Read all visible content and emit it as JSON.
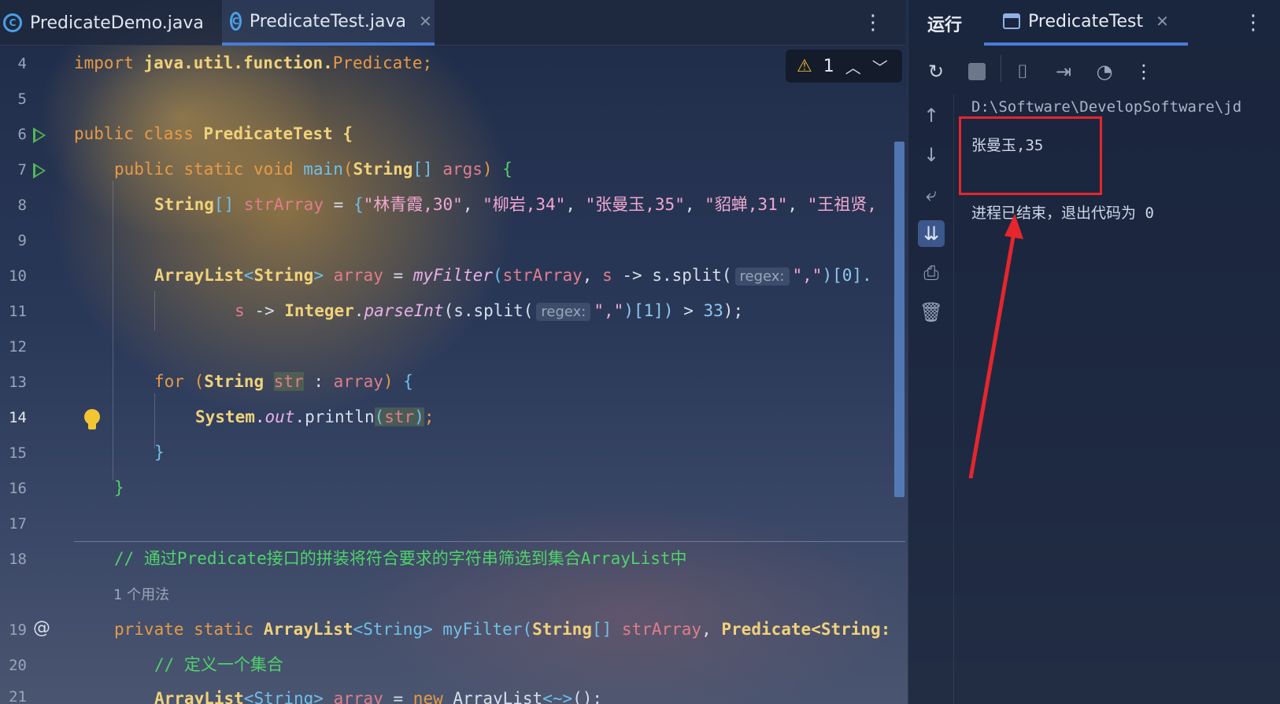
{
  "tabs": [
    {
      "label": "PredicateDemo.java"
    },
    {
      "label": "PredicateTest.java",
      "active": true
    }
  ],
  "inspection": {
    "count": "1"
  },
  "code_lines": [
    {
      "no": "4"
    },
    {
      "no": "5"
    },
    {
      "no": "6"
    },
    {
      "no": "7"
    },
    {
      "no": "8"
    },
    {
      "no": "9"
    },
    {
      "no": "10"
    },
    {
      "no": "11"
    },
    {
      "no": "12"
    },
    {
      "no": "13"
    },
    {
      "no": "14"
    },
    {
      "no": "15"
    },
    {
      "no": "16"
    },
    {
      "no": "17"
    },
    {
      "no": "18"
    },
    {
      "no": "19"
    },
    {
      "no": "20"
    },
    {
      "no": "21"
    }
  ],
  "code": {
    "l4": {
      "kw": "import",
      "pkg": "java.util.function.",
      "cls": "Predicate",
      "semi": ";"
    },
    "l6": {
      "kw1": "public",
      "kw2": "class",
      "name": "PredicateTest",
      "brace": "{"
    },
    "l7": {
      "kw1": "public",
      "kw2": "static",
      "kw3": "void",
      "fn": "main",
      "open": "(",
      "type": "String",
      "arr": "[]",
      "arg": "args",
      "close": ")",
      "brace": "{"
    },
    "l8": {
      "type": "String",
      "arr": "[]",
      "var": "strArray",
      "eq": "=",
      "open": "{",
      "s1": "\"林青霞,30\"",
      "s2": "\"柳岩,34\"",
      "s3": "\"张曼玉,35\"",
      "s4": "\"貂蝉,31\"",
      "s5": "\"王祖贤,"
    },
    "l10": {
      "type": "ArrayList",
      "gen": "<",
      "gtype": "String",
      "gend": ">",
      "var": "array",
      "eq": "=",
      "fn": "myFilter",
      "open": "(",
      "arg": "strArray",
      "comma": ",",
      "lam": "s",
      "arrow": "->",
      "call": "s.split(",
      "hint": "regex:",
      "str": "\",\"",
      "rest": ")[0]."
    },
    "l11": {
      "lam": "s",
      "arrow": "->",
      "cls": "Integer",
      "dot": ".",
      "fn": "parseInt",
      "call": "(s.split(",
      "hint": "regex:",
      "str": "\",\"",
      "rest": ")[1])",
      "gt": ">",
      "num": "33",
      "end": ");"
    },
    "l13": {
      "kw": "for",
      "open": "(",
      "type": "String",
      "var": "str",
      "colon": ":",
      "arr": "array",
      "close": ")",
      "brace": "{"
    },
    "l14": {
      "sys": "System",
      "dot": ".",
      "out": "out",
      "call": ".println",
      "open": "(",
      "var": "str",
      "close": ")",
      "semi": ";"
    },
    "l15": {
      "brace": "}"
    },
    "l16": {
      "brace": "}"
    },
    "l18": {
      "comment": "// 通过Predicate接口的拼装将符合要求的字符串筛选到集合ArrayList中"
    },
    "usages": "1 个用法",
    "l19": {
      "kw1": "private",
      "kw2": "static",
      "type": "ArrayList",
      "gen": "<String>",
      "fn": "myFilter",
      "open": "(",
      "ptype": "String",
      "arr": "[]",
      "param": "strArray",
      "comma": ",",
      "ptype2": "Predicate",
      "gen2": "<String:"
    },
    "l20": {
      "comment": "// 定义一个集合"
    },
    "l21": {
      "type": "ArrayList",
      "gen": "<String>",
      "var": "array",
      "eq": "=",
      "kw": "new",
      "cls": "ArrayList",
      "diamond": "<~>",
      "end": "();"
    }
  },
  "run_panel": {
    "title": "运行",
    "tab_label": "PredicateTest",
    "console": {
      "path": "D:\\Software\\DevelopSoftware\\jd",
      "output": "张曼玉,35",
      "exit": "进程已结束，退出代码为 0"
    }
  },
  "colors": {
    "highlight_box": "#e5262c",
    "accent": "#4b7bd6",
    "run_green": "#51b85a"
  }
}
